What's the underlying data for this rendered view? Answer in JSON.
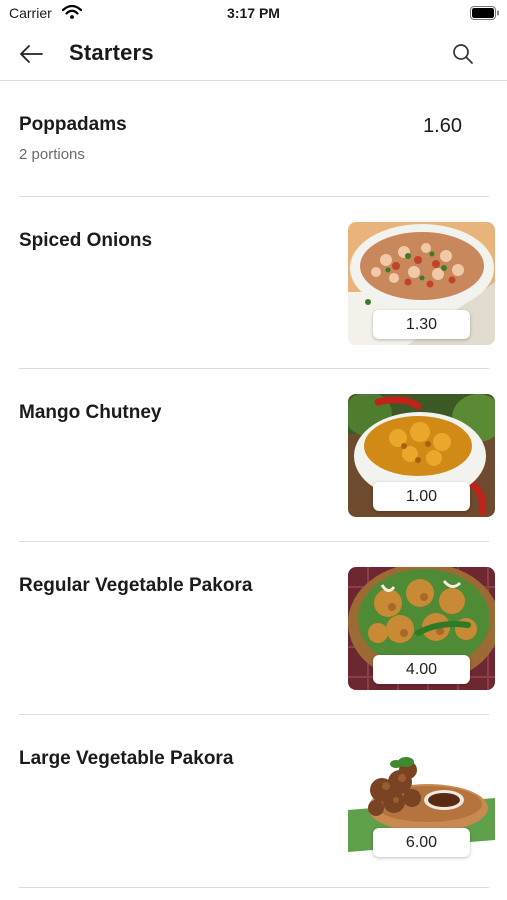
{
  "status_bar": {
    "carrier": "Carrier",
    "time": "3:17 PM"
  },
  "nav": {
    "title": "Starters",
    "back_icon": "arrow-left-icon",
    "search_icon": "search-icon"
  },
  "items": [
    {
      "name": "Poppadams",
      "description": "2 portions",
      "price": "1.60"
    },
    {
      "name": "Spiced Onions",
      "price": "1.30"
    },
    {
      "name": "Mango Chutney",
      "price": "1.00"
    },
    {
      "name": "Regular Vegetable Pakora",
      "price": "4.00"
    },
    {
      "name": "Large Vegetable Pakora",
      "price": "6.00"
    }
  ]
}
